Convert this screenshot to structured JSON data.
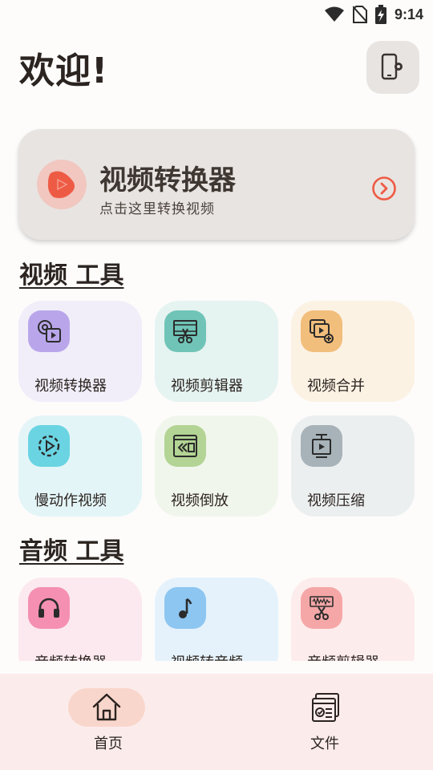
{
  "status_bar": {
    "time": "9:14"
  },
  "header": {
    "title": "欢迎!"
  },
  "hero": {
    "title": "视频转换器",
    "subtitle": "点击这里转换视频"
  },
  "sections": [
    {
      "title": "视频 工具",
      "tools": [
        {
          "label": "视频转换器",
          "icon": "gear-film-icon",
          "icon_bg": "#b9a6ea",
          "card_bg": "#f1eefa"
        },
        {
          "label": "视频剪辑器",
          "icon": "film-scissors-icon",
          "icon_bg": "#6fc4b7",
          "card_bg": "#e5f3f1"
        },
        {
          "label": "视频合并",
          "icon": "video-merge-icon",
          "icon_bg": "#f2be7c",
          "card_bg": "#fcf2e4"
        },
        {
          "label": "慢动作视频",
          "icon": "slow-motion-icon",
          "icon_bg": "#6ad4e2",
          "card_bg": "#e4f5f8"
        },
        {
          "label": "视频倒放",
          "icon": "rewind-icon",
          "icon_bg": "#b3d494",
          "card_bg": "#f1f6ec"
        },
        {
          "label": "视频压缩",
          "icon": "compress-icon",
          "icon_bg": "#a7b3b8",
          "card_bg": "#eceff0"
        }
      ]
    },
    {
      "title": "音频 工具",
      "tools": [
        {
          "label": "音频转换器",
          "icon": "headphones-icon",
          "icon_bg": "#f590b3",
          "card_bg": "#fce9ef"
        },
        {
          "label": "视频转音频",
          "icon": "music-note-icon",
          "icon_bg": "#8cc6f1",
          "card_bg": "#e5f2fb"
        },
        {
          "label": "音频剪辑器",
          "icon": "audio-scissors-icon",
          "icon_bg": "#f5a7a7",
          "card_bg": "#fdecec"
        }
      ]
    }
  ],
  "bottom_nav": {
    "home_label": "首页",
    "files_label": "文件",
    "active_color": "#f9d6cc"
  }
}
